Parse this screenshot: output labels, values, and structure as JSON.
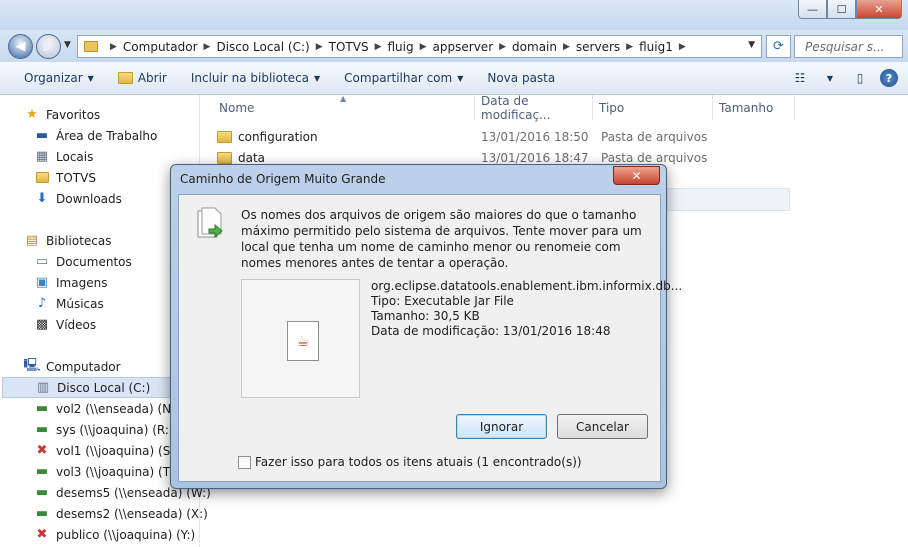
{
  "address": {
    "crumbs": [
      "Computador",
      "Disco Local (C:)",
      "TOTVS",
      "fluig",
      "appserver",
      "domain",
      "servers",
      "fluig1"
    ],
    "search_placeholder": "Pesquisar s..."
  },
  "toolbar": {
    "organize": "Organizar",
    "open": "Abrir",
    "include": "Incluir na biblioteca",
    "share": "Compartilhar com",
    "new_folder": "Nova pasta"
  },
  "sidebar": {
    "favorites": {
      "label": "Favoritos",
      "items": [
        "Área de Trabalho",
        "Locais",
        "TOTVS",
        "Downloads"
      ]
    },
    "libraries": {
      "label": "Bibliotecas",
      "items": [
        "Documentos",
        "Imagens",
        "Músicas",
        "Vídeos"
      ]
    },
    "computer": {
      "label": "Computador",
      "items": [
        "Disco Local (C:)",
        "vol2 (\\\\enseada) (N:)",
        "sys (\\\\joaquina) (R:)",
        "vol1 (\\\\joaquina) (S:)",
        "vol3 (\\\\joaquina) (T:)",
        "desems5 (\\\\enseada) (W:)",
        "desems2 (\\\\enseada) (X:)",
        "publico (\\\\joaquina) (Y:)"
      ]
    }
  },
  "columns": {
    "name": "Nome",
    "date": "Data de modificaç...",
    "type": "Tipo",
    "size": "Tamanho"
  },
  "files": [
    {
      "name": "configuration",
      "date": "13/01/2016 18:50",
      "type": "Pasta de arquivos"
    },
    {
      "name": "data",
      "date": "13/01/2016 18:47",
      "type": "Pasta de arquivos"
    }
  ],
  "dialog": {
    "title": "Caminho de Origem Muito Grande",
    "message": "Os nomes dos arquivos de origem são maiores do que o tamanho máximo permitido pelo sistema de arquivos. Tente mover para um local que tenha um nome de caminho menor ou renomeie com nomes menores antes de tentar a operação.",
    "file_name": "org.eclipse.datatools.enablement.ibm.informix.db...",
    "file_type": "Tipo: Executable Jar File",
    "file_size": "Tamanho: 30,5 KB",
    "file_date": "Data de modificação: 13/01/2016 18:48",
    "skip": "Ignorar",
    "cancel": "Cancelar",
    "apply_all": "Fazer isso para todos os itens atuais (1 encontrado(s))"
  },
  "colors": {
    "accent": "#3c7fb1",
    "folder": "#e3b540",
    "dialog_frame": "#a9c3e0"
  }
}
